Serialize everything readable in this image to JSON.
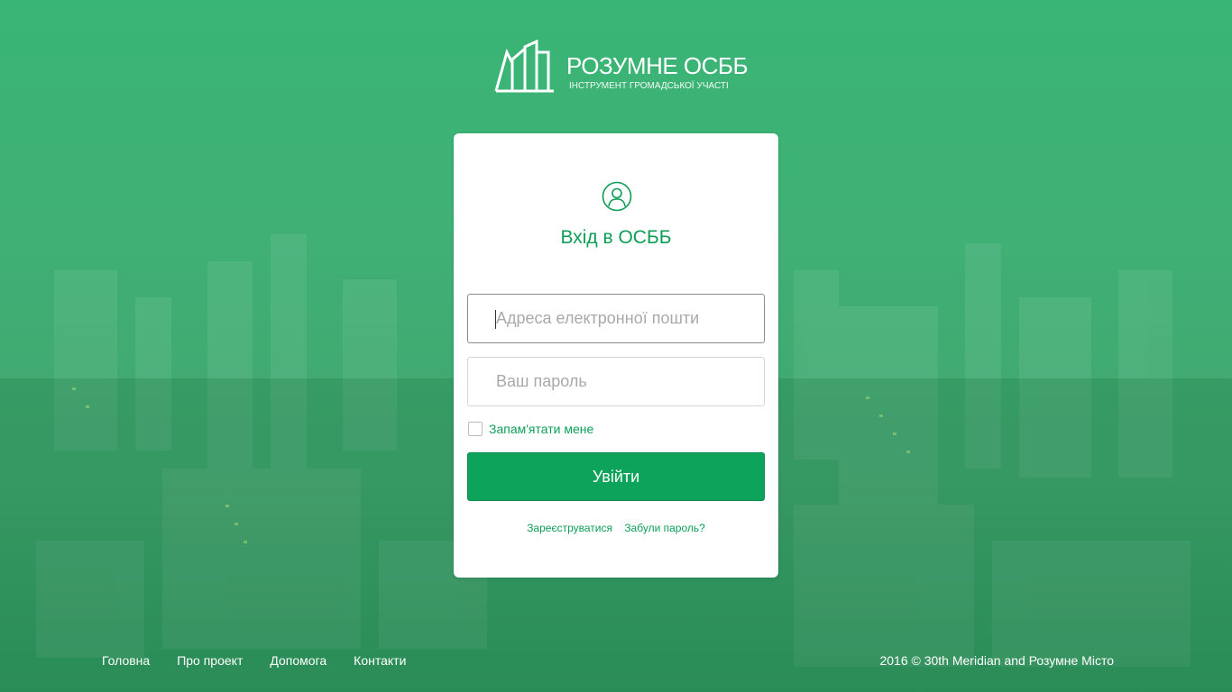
{
  "brand": {
    "title": "РОЗУМНЕ ОСББ",
    "subtitle": "ІНСТРУМЕНТ ГРОМАДСЬКОЇ УЧАСТІ"
  },
  "login": {
    "title": "Вхід в ОСББ",
    "email_placeholder": "Адреса електронної пошти",
    "password_placeholder": "Ваш пароль",
    "remember_label": "Запам'ятати мене",
    "submit_label": "Увійти",
    "register_link": "Зареєструватися",
    "forgot_link": "Забули пароль?"
  },
  "footer": {
    "nav": [
      "Головна",
      "Про проект",
      "Допомога",
      "Контакти"
    ],
    "copyright": "2016 © 30th Meridian and Розумне Місто"
  },
  "colors": {
    "accent": "#0da35a",
    "background_overlay": "#2aaf69",
    "text_accent": "#0d9e56"
  },
  "icons": {
    "user": "user-circle-icon",
    "logo": "buildings-logo-icon"
  }
}
